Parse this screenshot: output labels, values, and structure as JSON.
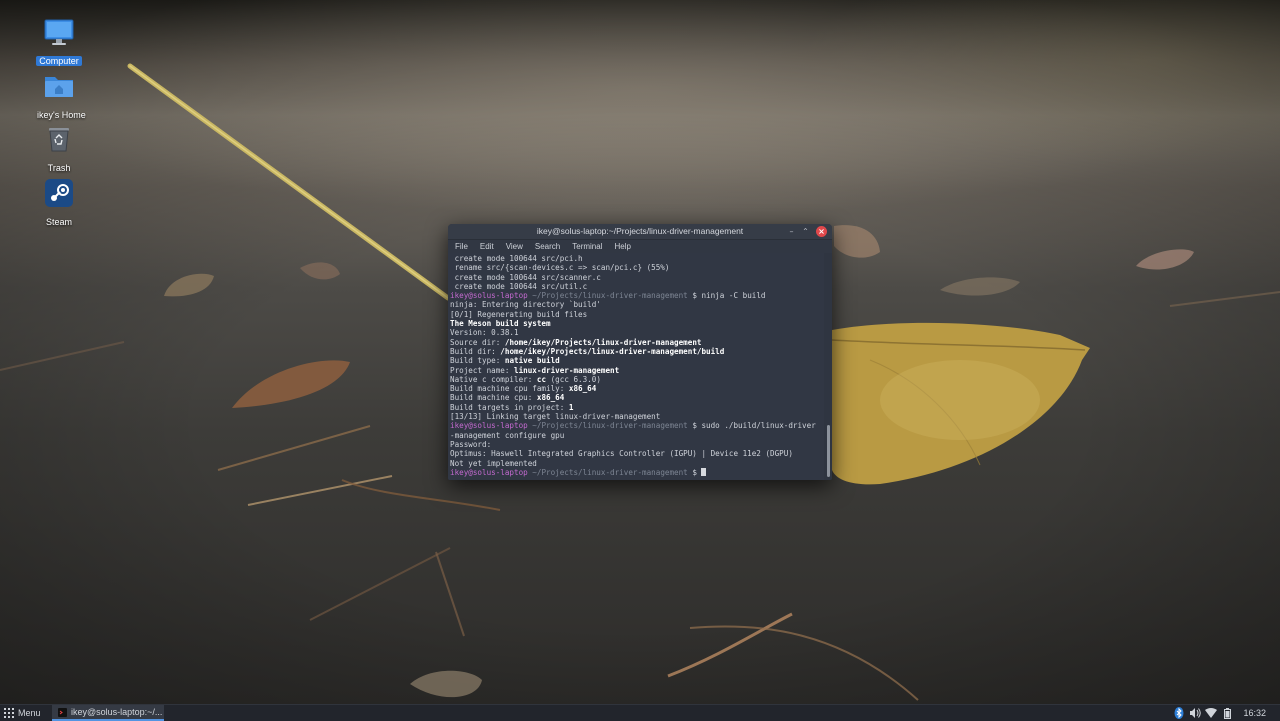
{
  "desktop": {
    "icons": [
      {
        "label": "Computer",
        "icon": "computer-icon",
        "selected": true
      },
      {
        "label": "ikey's Home",
        "icon": "home-folder-icon"
      },
      {
        "label": "Trash",
        "icon": "trash-icon"
      },
      {
        "label": "Steam",
        "icon": "steam-icon"
      }
    ]
  },
  "terminal": {
    "title": "ikey@solus-laptop:~/Projects/linux-driver-management",
    "menu": [
      "File",
      "Edit",
      "View",
      "Search",
      "Terminal",
      "Help"
    ],
    "lines": {
      "l1": " create mode 100644 src/pci.h",
      "l2": " rename src/{scan-devices.c => scan/pci.c} (55%)",
      "l3": " create mode 100644 src/scanner.c",
      "l4": " create mode 100644 src/util.c",
      "p1_user": "ikey@solus-laptop",
      "p1_path": " ~/Projects/linux-driver-management ",
      "p1_cmd": "$ ninja -C build",
      "l5": "ninja: Entering directory `build'",
      "l6": "[0/1] Regenerating build files",
      "l7": "The Meson build system",
      "l8": "Version: 0.38.1",
      "l9_key": "Source dir: ",
      "l9_val": "/home/ikey/Projects/linux-driver-management",
      "l10_key": "Build dir: ",
      "l10_val": "/home/ikey/Projects/linux-driver-management/build",
      "l11_key": "Build type: ",
      "l11_val": "native build",
      "l12_key": "Project name: ",
      "l12_val": "linux-driver-management",
      "l13_key": "Native c compiler: ",
      "l13_val": "cc",
      "l13_rest": " (gcc 6.3.0)",
      "l14_key": "Build machine cpu family: ",
      "l14_val": "x86_64",
      "l15_key": "Build machine cpu: ",
      "l15_val": "x86_64",
      "l16_key": "Build targets in project: ",
      "l16_val": "1",
      "l17": "[13/13] Linking target linux-driver-management",
      "p2_user": "ikey@solus-laptop",
      "p2_path": " ~/Projects/linux-driver-management ",
      "p2_cmd": "$ sudo ./build/linux-driver",
      "l18": "-management configure gpu",
      "l19": "Password:",
      "l20": "Optimus: Haswell Integrated Graphics Controller (IGPU) | Device 11e2 (DGPU)",
      "l21": "Not yet implemented",
      "p3_user": "ikey@solus-laptop",
      "p3_path": " ~/Projects/linux-driver-management ",
      "p3_cmd": "$ "
    }
  },
  "panel": {
    "menu_label": "Menu",
    "task_label": "ikey@solus-laptop:~/...",
    "clock": "16:32",
    "tray_icons": [
      "bluetooth-icon",
      "volume-icon",
      "wifi-icon",
      "battery-icon"
    ]
  }
}
